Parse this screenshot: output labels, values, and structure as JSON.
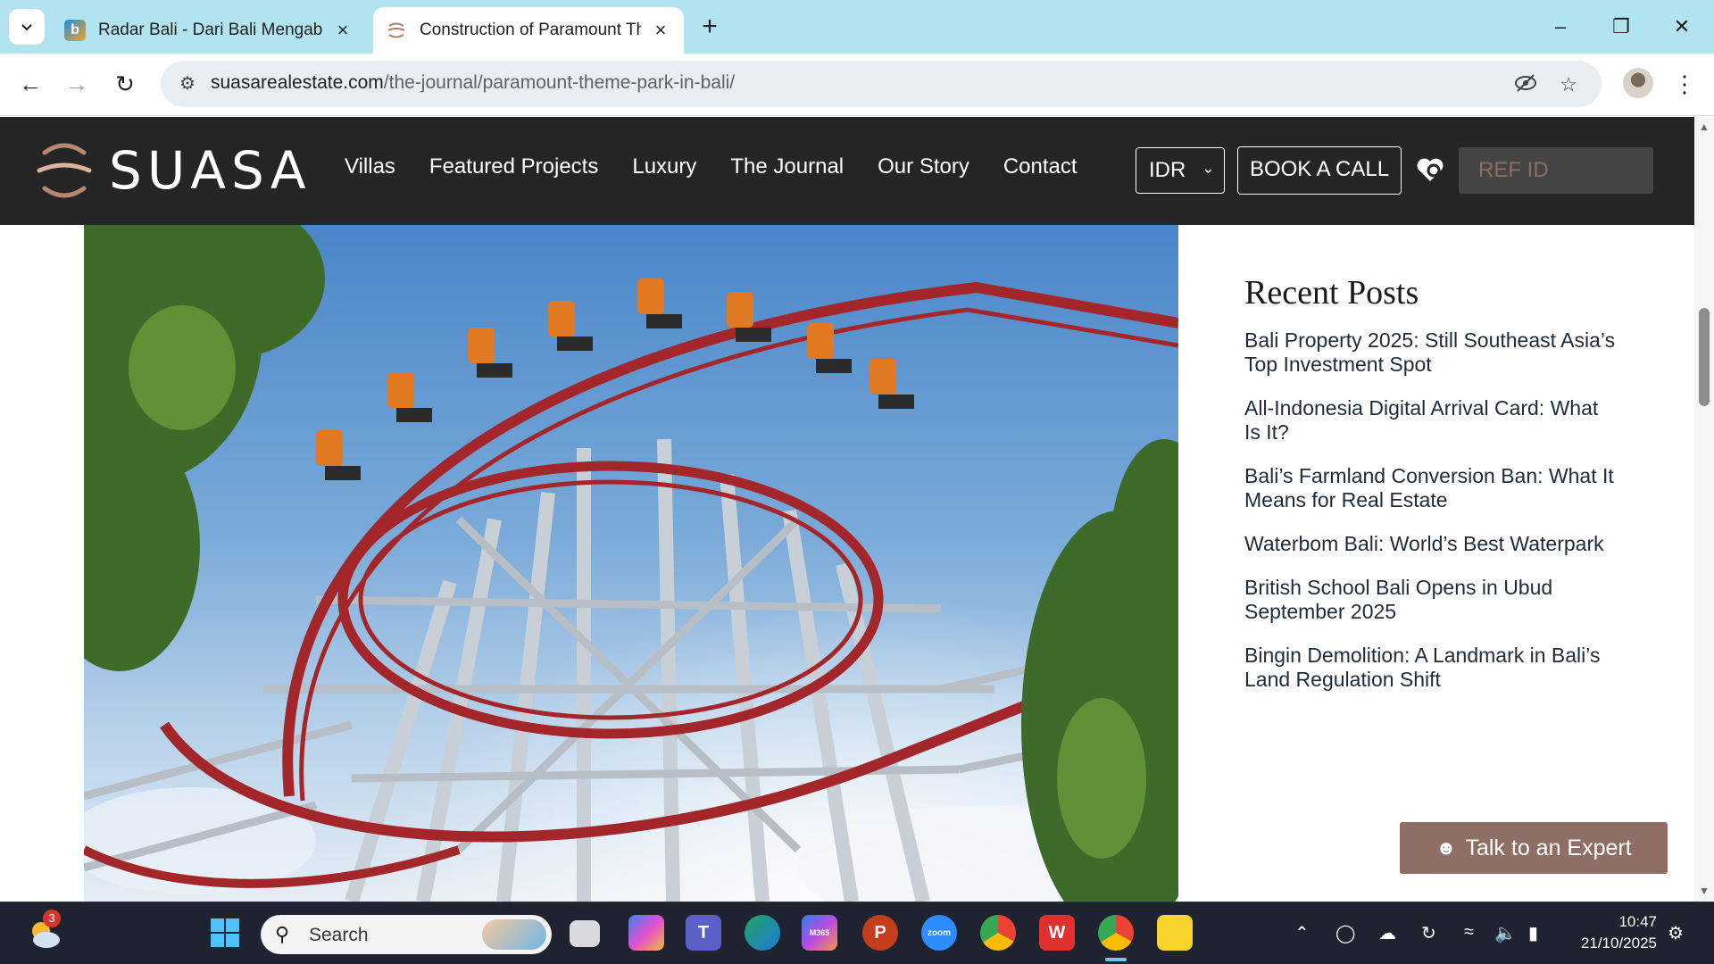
{
  "browser": {
    "tabs": [
      {
        "title": "Radar Bali - Dari Bali Mengabarkan",
        "favicon": "radar-bali-icon",
        "active": false
      },
      {
        "title": "Construction of Paramount Theme Park in Bali",
        "favicon": "suasa-icon",
        "active": true
      }
    ],
    "new_tab": "+",
    "url_host": "suasarealestate.com",
    "url_path": "/the-journal/paramount-theme-park-in-bali/"
  },
  "site": {
    "logo_text": "SUASA",
    "nav": [
      "Villas",
      "Featured Projects",
      "Luxury",
      "The Journal",
      "Our Story",
      "Contact"
    ],
    "currency": "IDR",
    "book_call": "BOOK A CALL",
    "ref_placeholder": "REF ID",
    "accent_color": "#8f6e66",
    "header_bg": "#262525"
  },
  "sidebar": {
    "heading": "Recent Posts",
    "posts": [
      "Bali Property 2025: Still Southeast Asia’s Top Investment Spot",
      "All-Indonesia Digital Arrival Card: What Is It?",
      "Bali’s Farmland Conversion Ban: What It Means for Real Estate",
      "Waterbom Bali: World’s Best Waterpark",
      "British School Bali Opens in Ubud September 2025",
      "Bingin Demolition: A Landmark in Bali’s Land Regulation Shift"
    ]
  },
  "talk_button": "Talk to an Expert",
  "taskbar": {
    "search_label": "Search",
    "weather_badge": "3",
    "time": "10:47",
    "date": "21/10/2025"
  }
}
